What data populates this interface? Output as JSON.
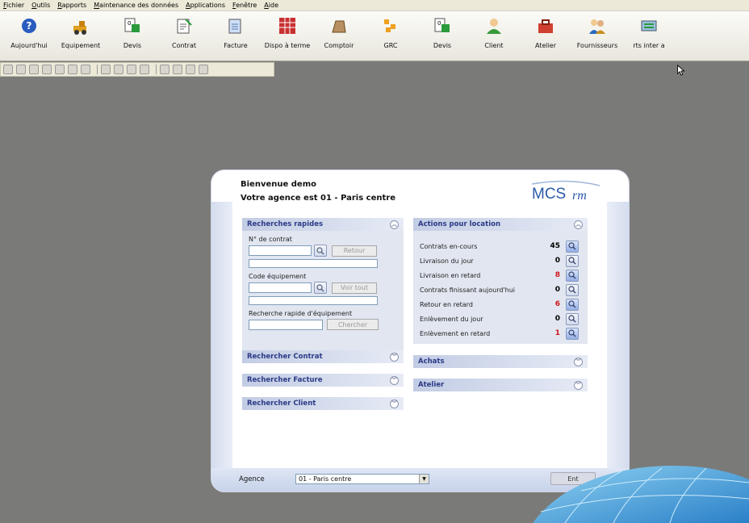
{
  "menu": [
    "Fichier",
    "Outils",
    "Rapports",
    "Maintenance des données",
    "Applications",
    "Fenêtre",
    "Aide"
  ],
  "toolbar": [
    {
      "label": "Aujourd'hui",
      "icon": "help-icon"
    },
    {
      "label": "Equipement",
      "icon": "loader-icon"
    },
    {
      "label": "Devis",
      "icon": "quote-icon"
    },
    {
      "label": "Contrat",
      "icon": "contract-icon"
    },
    {
      "label": "Facture",
      "icon": "invoice-icon"
    },
    {
      "label": "Dispo à terme",
      "icon": "calendar-grid-icon"
    },
    {
      "label": "Comptoir",
      "icon": "counter-icon"
    },
    {
      "label": "GRC",
      "icon": "crm-icon"
    },
    {
      "label": "Devis",
      "icon": "quote-icon"
    },
    {
      "label": "Client",
      "icon": "client-icon"
    },
    {
      "label": "Atelier",
      "icon": "toolbox-icon"
    },
    {
      "label": "Fournisseurs",
      "icon": "suppliers-icon"
    },
    {
      "label": "rts inter a",
      "icon": "transfer-icon"
    }
  ],
  "welcome": {
    "line1": "Bienvenue demo",
    "line2": "Votre agence est 01  - Paris centre",
    "logo_main": "MCS",
    "logo_sub": "rm"
  },
  "quick_search": {
    "title": "Recherches rapides",
    "contract_label": "N° de contrat",
    "retour_button": "Retour",
    "equipment_label": "Code équipement",
    "voirtout_button": "Voir tout",
    "quick_equipment_label": "Recherche rapide d'équipement",
    "chercher_button": "Chercher"
  },
  "collapsed_left": [
    "Rechercher Contrat",
    "Rechercher Facture",
    "Rechercher Client"
  ],
  "actions": {
    "title": "Actions pour location",
    "rows": [
      {
        "label": "Contrats en-cours",
        "value": "45",
        "color": "#000000"
      },
      {
        "label": "Livraison du jour",
        "value": "0",
        "color": "#000000"
      },
      {
        "label": "Livraison en retard",
        "value": "8",
        "color": "#d0161c"
      },
      {
        "label": "Contrats finissant aujourd'hui",
        "value": "0",
        "color": "#000000"
      },
      {
        "label": "Retour en retard",
        "value": "6",
        "color": "#d0161c"
      },
      {
        "label": "Enlèvement du jour",
        "value": "0",
        "color": "#000000"
      },
      {
        "label": "Enlèvement en retard",
        "value": "1",
        "color": "#d0161c"
      }
    ]
  },
  "collapsed_right": [
    "Achats",
    "Atelier"
  ],
  "agence": {
    "label": "Agence",
    "value": "01  - Paris centre",
    "enter": "Ent"
  },
  "colors": {
    "panel_title": "#2b3a86",
    "desktop": "#7a7a78",
    "card": "#ffffff"
  }
}
